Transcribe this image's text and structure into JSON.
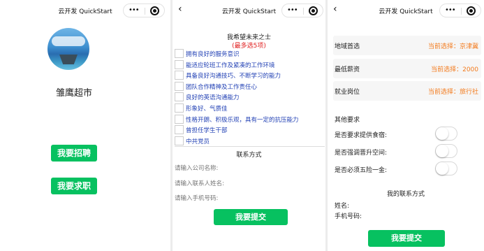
{
  "nav": {
    "title": "云开发 QuickStart",
    "dots": "•••"
  },
  "panel1": {
    "shop_name": "雏鹰超市",
    "recruit_button": "我要招聘",
    "job_button": "我要求职"
  },
  "panel2": {
    "title": "我希望未来之士",
    "subtitle": "(最多选5项)",
    "options": [
      "拥有良好的服务意识",
      "能适应轮班工作及紧凑的工作环境",
      "具备良好沟通技巧、不断学习的能力",
      "团队合作精神及工作责任心",
      "良好的英语沟通能力",
      "形象好、气质佳",
      "性格开朗、积极乐观，具有一定的抗压能力",
      "曾担任学生干部",
      "中共党员"
    ],
    "contact_title": "联系方式",
    "company_placeholder": "请输入公司名称:",
    "contact_placeholder": "请输入联系人姓名:",
    "phone_placeholder": "请输入手机号码:",
    "submit_button": "我要提交"
  },
  "panel3": {
    "region_label": "地域首选",
    "region_value": "当前选择：京津冀",
    "salary_label": "最低薪资",
    "salary_value": "当前选择：2000",
    "position_label": "就业岗位",
    "position_value": "当前选择：旅行社",
    "other_title": "其他要求",
    "switch1_label": "是否要求提供食宿:",
    "switch2_label": "是否强调晋升空间:",
    "switch3_label": "是否必须五险一金:",
    "my_contact_title": "我的联系方式",
    "name_label": "姓名:",
    "phone_label": "手机号码:",
    "submit_button": "我要提交",
    "accent_color": "#f37b1d"
  },
  "colors": {
    "primary_green": "#07c160",
    "link_blue": "#2342b5",
    "required_red": "#e02020"
  }
}
